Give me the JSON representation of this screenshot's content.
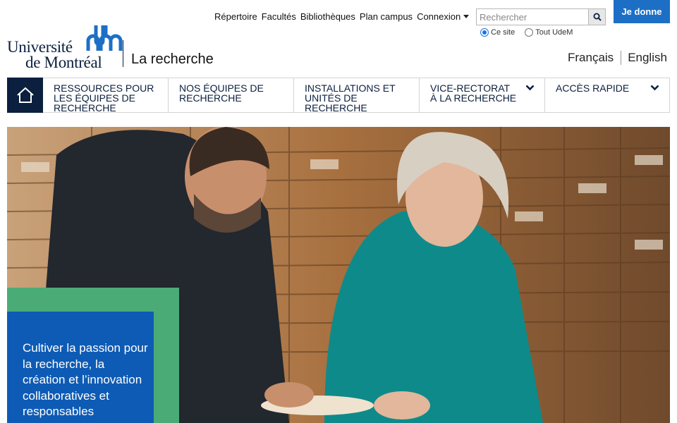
{
  "utility_links": [
    "Répertoire",
    "Facultés",
    "Bibliothèques",
    "Plan campus",
    "Connexion"
  ],
  "search": {
    "placeholder": "Rechercher",
    "scope_options": [
      "Ce site",
      "Tout UdeM"
    ],
    "selected_scope": "Ce site"
  },
  "donate_label": "Je donne",
  "logo": {
    "line1": "Université",
    "line2": "de Montréal"
  },
  "site_name": "La recherche",
  "languages": [
    "Français",
    "English"
  ],
  "nav": {
    "home_icon": "home-icon",
    "items": [
      {
        "label": "Ressources pour les équipes de recherche",
        "has_dropdown": false
      },
      {
        "label": "Nos équipes de recherche",
        "has_dropdown": false
      },
      {
        "label": "Installations et unités de recherche",
        "has_dropdown": false
      },
      {
        "label": "Vice-rectorat à la recherche",
        "has_dropdown": true
      },
      {
        "label": "Accès rapide",
        "has_dropdown": true
      }
    ]
  },
  "hero": {
    "tagline": "Cultiver la passion pour la recherche, la création et l’innovation collaboratives et responsables"
  },
  "colors": {
    "navy": "#0b1f3f",
    "donate_blue": "#1d6fc6",
    "tagline_blue": "#0e5bb5",
    "tagline_green": "#4bab77"
  }
}
